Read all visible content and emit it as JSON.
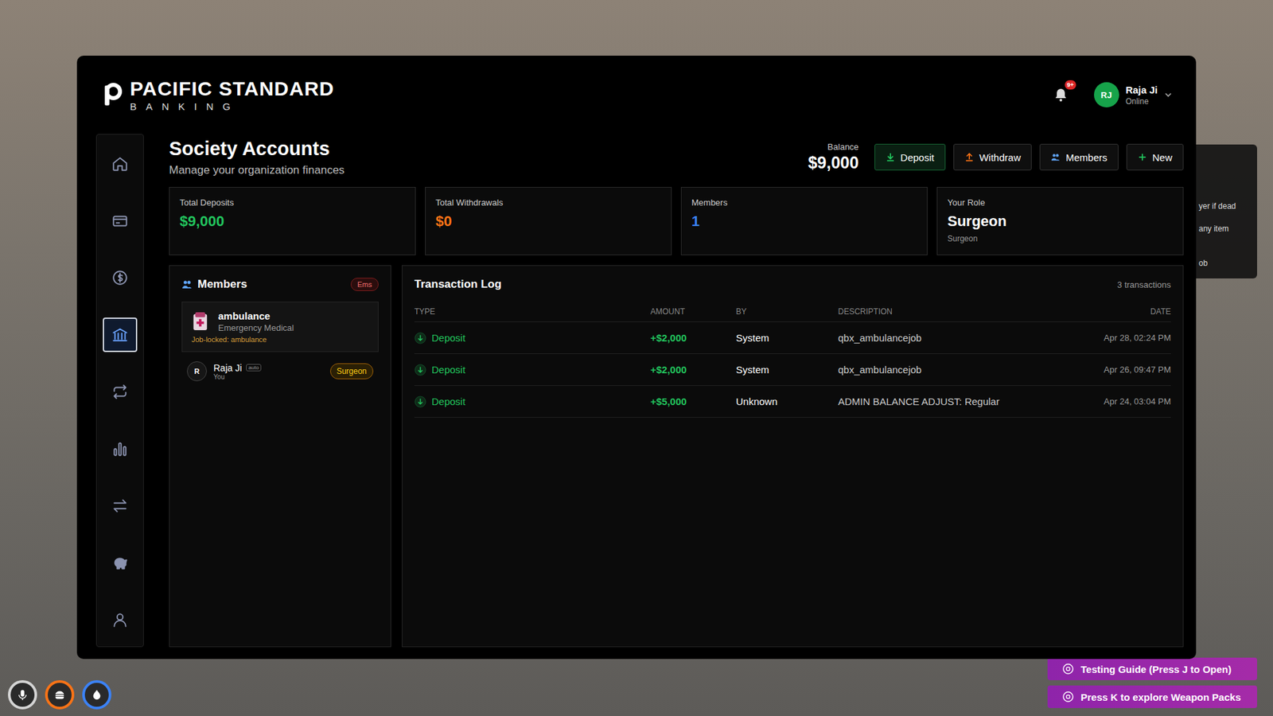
{
  "brand": {
    "title": "PACIFIC STANDARD",
    "subtitle": "BANKING"
  },
  "notifications": {
    "badge": "9+"
  },
  "user": {
    "initials": "RJ",
    "name": "Raja Ji",
    "status": "Online"
  },
  "sidebar": {
    "items": [
      {
        "kind": "home",
        "selected": false
      },
      {
        "kind": "card",
        "selected": false
      },
      {
        "kind": "dollar",
        "selected": false
      },
      {
        "kind": "bank",
        "selected": true
      },
      {
        "kind": "repeat",
        "selected": false
      },
      {
        "kind": "chart",
        "selected": false
      },
      {
        "kind": "transfer",
        "selected": false
      },
      {
        "kind": "piggy",
        "selected": false
      },
      {
        "kind": "user",
        "selected": false
      }
    ]
  },
  "page": {
    "title": "Society Accounts",
    "subtitle": "Manage your organization finances"
  },
  "balance": {
    "label": "Balance",
    "value": "$9,000"
  },
  "actions": [
    {
      "label": "Deposit",
      "kind": "deposit"
    },
    {
      "label": "Withdraw",
      "kind": "withdraw"
    },
    {
      "label": "Members",
      "kind": "members"
    },
    {
      "label": "New",
      "kind": "new"
    }
  ],
  "stats": [
    {
      "label": "Total Deposits",
      "value": "$9,000",
      "sub": "",
      "color": "#22c55e"
    },
    {
      "label": "Total Withdrawals",
      "value": "$0",
      "sub": "",
      "color": "#f97316"
    },
    {
      "label": "Members",
      "value": "1",
      "sub": "",
      "color": "#3b82f6"
    },
    {
      "label": "Your Role",
      "value": "Surgeon",
      "sub": "Surgeon",
      "color": "#ffffff"
    }
  ],
  "members_panel": {
    "title": "Members",
    "tag": "Ems",
    "account": {
      "name": "ambulance",
      "type": "Emergency Medical",
      "lock": "Job-locked: ambulance"
    },
    "members": [
      {
        "initial": "R",
        "name": "Raja Ji",
        "badge": "auto",
        "note": "You",
        "role": "Surgeon"
      }
    ]
  },
  "transactions": {
    "title": "Transaction Log",
    "count": "3 transactions",
    "columns": [
      "TYPE",
      "AMOUNT",
      "BY",
      "DESCRIPTION",
      "DATE"
    ],
    "rows": [
      {
        "type": "Deposit",
        "amount": "+$2,000",
        "by": "System",
        "description": "qbx_ambulancejob",
        "date": "Apr 28, 02:24 PM"
      },
      {
        "type": "Deposit",
        "amount": "+$2,000",
        "by": "System",
        "description": "qbx_ambulancejob",
        "date": "Apr 26, 09:47 PM"
      },
      {
        "type": "Deposit",
        "amount": "+$5,000",
        "by": "Unknown",
        "description": "ADMIN BALANCE ADJUST: Regular",
        "date": "Apr 24, 03:04 PM"
      }
    ]
  },
  "background_window": {
    "lines": [
      "yer if dead",
      "any item",
      "ob"
    ]
  },
  "hud": {
    "buttons": [
      "Testing Guide (Press J to Open)",
      "Press K to explore Weapon Packs"
    ],
    "status": [
      {
        "kind": "mic",
        "color": "#d4d4d4"
      },
      {
        "kind": "food",
        "color": "#f97316"
      },
      {
        "kind": "water",
        "color": "#3b82f6"
      }
    ]
  }
}
